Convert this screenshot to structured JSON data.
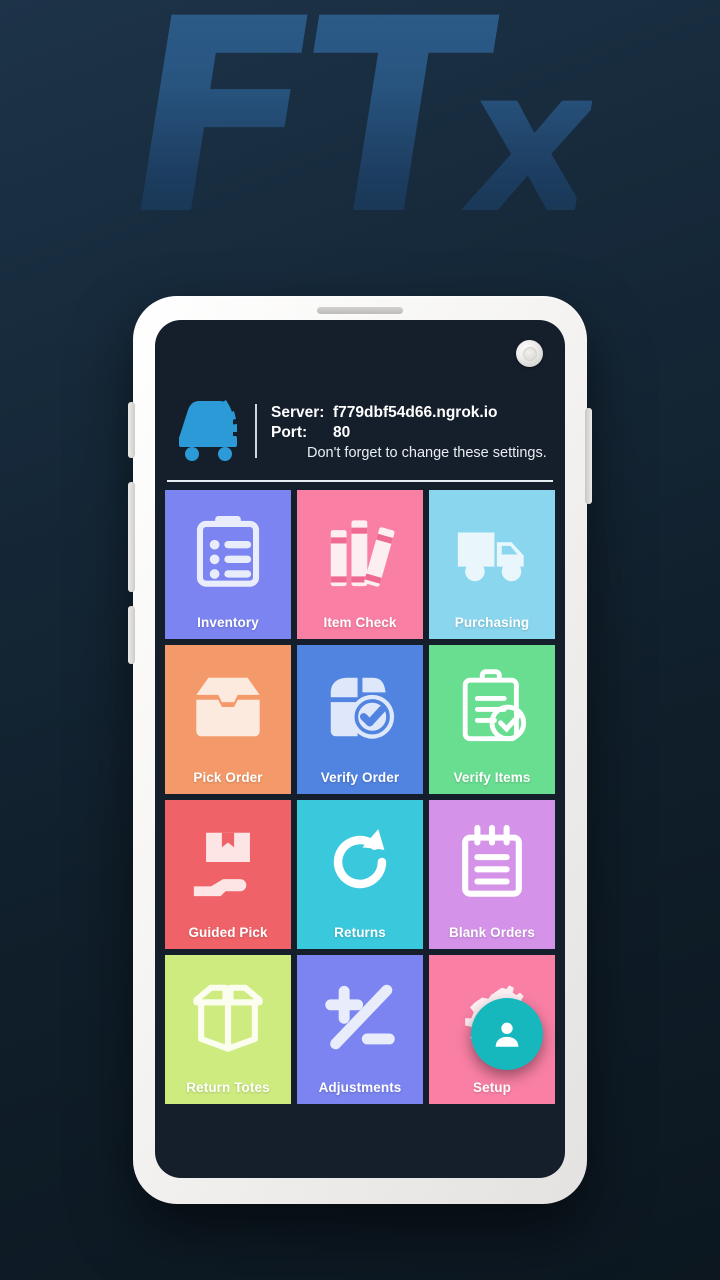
{
  "background": {
    "watermark_main": "FT",
    "watermark_lower": "x",
    "gradient_from": "#1d3348",
    "gradient_to": "#0c1720"
  },
  "device": {
    "frame_color": "#f4f2f0",
    "screen_bg": "#151f2b",
    "camera": "front-camera",
    "earpiece": "earpiece-speaker"
  },
  "header": {
    "logo_name": "ftx-warehouse-forklift-logo",
    "logo_color": "#2b9ad6",
    "server_label": "Server:",
    "server_value": "f779dbf54d66.ngrok.io",
    "port_label": "Port:",
    "port_value": "80",
    "note": "Don't forget to change these settings."
  },
  "grid": {
    "tiles": [
      {
        "label": "Inventory",
        "icon": "clipboard-list-icon",
        "bg": "#7b84f0",
        "art": "#e9ecfb"
      },
      {
        "label": "Item Check",
        "icon": "books-shelf-icon",
        "bg": "#f97fa4",
        "art": "#fdeef2"
      },
      {
        "label": "Purchasing",
        "icon": "delivery-truck-icon",
        "bg": "#8ad6ee",
        "art": "#e9f7fd"
      },
      {
        "label": "Pick Order",
        "icon": "open-box-icon",
        "bg": "#f49a6a",
        "art": "#fdeade"
      },
      {
        "label": "Verify Order",
        "icon": "box-check-icon",
        "bg": "#5183e0",
        "art": "#dfe8fa"
      },
      {
        "label": "Verify Items",
        "icon": "clipboard-check-icon",
        "bg": "#69dd90",
        "art": "#ffffff"
      },
      {
        "label": "Guided Pick",
        "icon": "hand-box-icon",
        "bg": "#ef6368",
        "art": "#fde5e6"
      },
      {
        "label": "Returns",
        "icon": "refresh-arrow-icon",
        "bg": "#3ac8dd",
        "art": "#ffffff"
      },
      {
        "label": "Blank Orders",
        "icon": "notepad-lines-icon",
        "bg": "#d492e8",
        "art": "#ffffff"
      },
      {
        "label": "Return Totes",
        "icon": "open-carton-icon",
        "bg": "#cdeb7e",
        "art": "#fbfdef"
      },
      {
        "label": "Adjustments",
        "icon": "plus-minus-icon",
        "bg": "#7b84f0",
        "art": "#e9ecfb"
      },
      {
        "label": "Setup",
        "icon": "gears-icon",
        "bg": "#f97fa4",
        "art": "#fdeef2"
      }
    ]
  },
  "fab": {
    "icon": "user-account-icon",
    "color": "#17b8bd",
    "icon_color": "#ffffff"
  }
}
